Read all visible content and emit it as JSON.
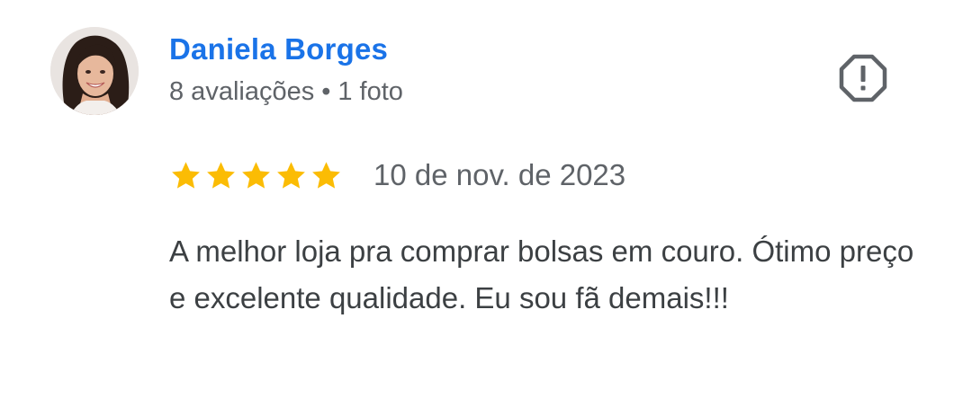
{
  "review": {
    "author": {
      "name": "Daniela Borges",
      "reviews_count": "8 avaliações",
      "separator": "•",
      "photos_count": "1 foto",
      "avatar_icon": "profile-photo"
    },
    "report_icon": "report-flag-octagon-icon",
    "rating": {
      "stars": 5,
      "max": 5,
      "star_color": "#fbbc04"
    },
    "date": "10 de nov. de 2023",
    "text": "A melhor loja pra comprar bolsas em couro. Ótimo preço e excelente qualidade. Eu sou fã demais!!!"
  },
  "colors": {
    "name_link": "#1a73e8",
    "meta_text": "#5f6368",
    "body_text": "#3c4043",
    "icon": "#5f6368"
  }
}
